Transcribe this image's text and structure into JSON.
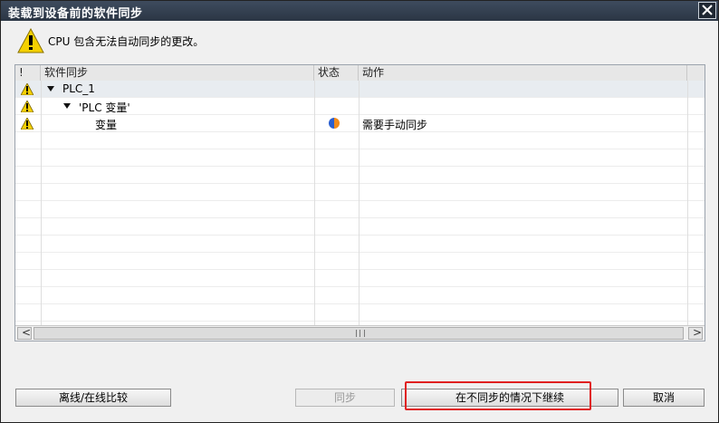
{
  "dialog": {
    "title": "装载到设备前的软件同步",
    "message": "CPU 包含无法自动同步的更改。"
  },
  "grid": {
    "headers": {
      "warn": "!",
      "sync": "软件同步",
      "status": "状态",
      "action": "动作"
    },
    "rows": [
      {
        "warning": true,
        "expand": true,
        "label": "PLC_1",
        "status": "",
        "action": ""
      },
      {
        "warning": true,
        "expand": true,
        "label": "'PLC 变量'",
        "status": "",
        "action": ""
      },
      {
        "warning": true,
        "expand": false,
        "label": "变量",
        "status": "partial-sync-icon",
        "action": "需要手动同步"
      }
    ],
    "scroll": {
      "left_arrow": "<",
      "right_arrow": ">"
    }
  },
  "buttons": {
    "compare": "离线/在线比较",
    "sync": "同步",
    "continue": "在不同步的情况下继续",
    "cancel": "取消"
  },
  "colors": {
    "titlebar": "#2b3644",
    "highlight": "#e02020",
    "warning": "#f5d000"
  }
}
